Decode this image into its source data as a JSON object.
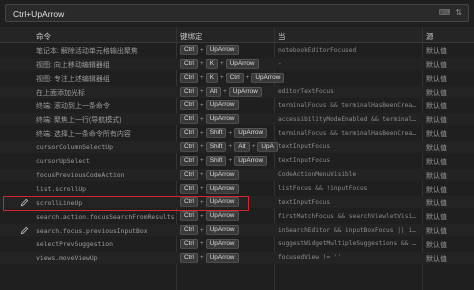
{
  "search": {
    "value": "Ctrl+UpArrow"
  },
  "header": {
    "command": "命令",
    "keybinding": "键绑定",
    "when": "当",
    "source": "源"
  },
  "rows": [
    {
      "command": "笔记本: 解除活动单元格输出聚焦",
      "keys": [
        "Ctrl",
        "UpArrow"
      ],
      "when": "notebookEditorFocused",
      "source": "默认值"
    },
    {
      "command": "视图: 向上移动编辑器组",
      "keys": [
        "Ctrl",
        "K",
        "UpArrow"
      ],
      "when": "-",
      "source": "默认值"
    },
    {
      "command": "视图: 专注上述编辑器组",
      "keys": [
        "Ctrl",
        "K",
        "Ctrl",
        "UpArrow"
      ],
      "when": "-",
      "source": "默认值"
    },
    {
      "command": "在上面添加光标",
      "keys": [
        "Ctrl",
        "Alt",
        "UpArrow"
      ],
      "when": "editorTextFocus",
      "source": "默认值"
    },
    {
      "command": "终端: 滚动到上一条命令",
      "keys": [
        "Ctrl",
        "UpArrow"
      ],
      "when": "terminalFocus && terminalHasBeenCreat…",
      "source": "默认值"
    },
    {
      "command": "终端: 聚焦上一行(导航模式)",
      "keys": [
        "Ctrl",
        "UpArrow"
      ],
      "when": "accessibilityModeEnabled && terminalF…",
      "source": "默认值"
    },
    {
      "command": "终端: 选择上一条命令所有内容",
      "keys": [
        "Ctrl",
        "Shift",
        "UpArrow"
      ],
      "when": "terminalFocus && terminalHasBeenCreat…",
      "source": "默认值"
    },
    {
      "command": "cursorColumnSelectUp",
      "keys": [
        "Ctrl",
        "Shift",
        "Alt",
        "UpA"
      ],
      "when": "textInputFocus",
      "source": "默认值"
    },
    {
      "command": "cursorUpSelect",
      "keys": [
        "Ctrl",
        "Shift",
        "UpArrow"
      ],
      "when": "textInputFocus",
      "source": "默认值"
    },
    {
      "command": "focusPreviousCodeAction",
      "keys": [
        "Ctrl",
        "UpArrow"
      ],
      "when": "CodeActionMenuVisible",
      "source": "默认值"
    },
    {
      "command": "list.scrollUp",
      "keys": [
        "Ctrl",
        "UpArrow"
      ],
      "when": "listFocus && !inputFocus",
      "source": "默认值"
    },
    {
      "command": "scrollLineUp",
      "keys": [
        "Ctrl",
        "UpArrow"
      ],
      "when": "textInputFocus",
      "source": "默认值"
    },
    {
      "command": "search.action.focusSearchFromResults",
      "keys": [
        "Ctrl",
        "UpArrow"
      ],
      "when": "firstMatchFocus && searchViewletVisib…",
      "source": "默认值"
    },
    {
      "command": "search.focus.previousInputBox",
      "keys": [
        "Ctrl",
        "UpArrow"
      ],
      "when": "inSearchEditor && inputBoxFocus || in…",
      "source": "默认值"
    },
    {
      "command": "selectPrevSuggestion",
      "keys": [
        "Ctrl",
        "UpArrow"
      ],
      "when": "suggestWidgetMultipleSuggestions && s…",
      "source": "默认值"
    },
    {
      "command": "views.moveViewUp",
      "keys": [
        "Ctrl",
        "UpArrow"
      ],
      "when": "focusedView != ''",
      "source": "默认值"
    }
  ]
}
